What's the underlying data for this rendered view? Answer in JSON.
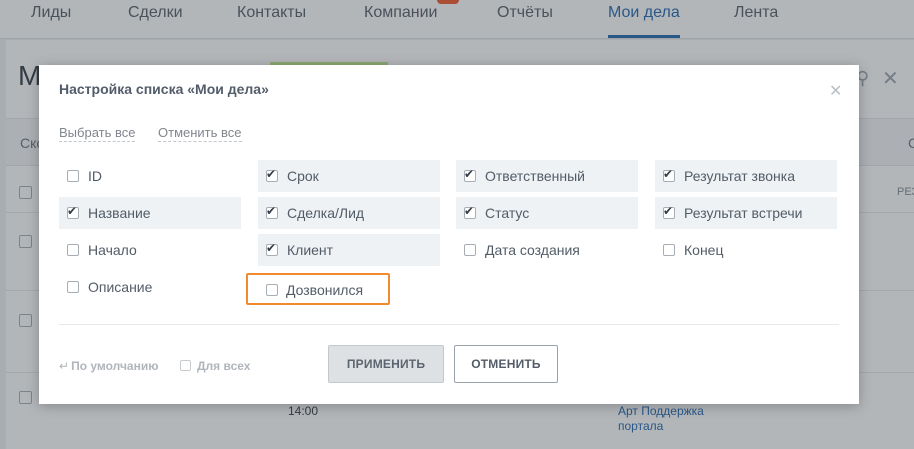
{
  "nav": {
    "tabs": [
      "Лиды",
      "Сделки",
      "Контакты",
      "Компании",
      "Отчёты",
      "Мои дела",
      "Лента"
    ],
    "active": "Мои дела"
  },
  "background": {
    "title": "М",
    "toolbar_text": "Ско",
    "column_header_result": "РЕЗ",
    "column_c": "С",
    "row_time": "14:00",
    "row_link": "Арт Поддержка портала"
  },
  "modal": {
    "title": "Настройка списка «Мои дела»",
    "select_all": "Выбрать все",
    "deselect_all": "Отменить все",
    "options": [
      {
        "label": "ID",
        "checked": false
      },
      {
        "label": "Срок",
        "checked": true
      },
      {
        "label": "Ответственный",
        "checked": true
      },
      {
        "label": "Результат звонка",
        "checked": true
      },
      {
        "label": "Название",
        "checked": true
      },
      {
        "label": "Сделка/Лид",
        "checked": true
      },
      {
        "label": "Статус",
        "checked": true
      },
      {
        "label": "Результат встречи",
        "checked": true
      },
      {
        "label": "Начало",
        "checked": false
      },
      {
        "label": "Клиент",
        "checked": true
      },
      {
        "label": "Дата создания",
        "checked": false
      },
      {
        "label": "Конец",
        "checked": false
      },
      {
        "label": "Описание",
        "checked": false
      },
      {
        "label": "Дозвонился",
        "checked": false,
        "highlighted": true
      }
    ],
    "default_link": "По умолчанию",
    "for_all_label": "Для всех",
    "for_all_checked": false,
    "apply_button": "ПРИМЕНИТЬ",
    "cancel_button": "ОТМЕНИТЬ"
  },
  "colors": {
    "accent": "#2067b0",
    "highlight_border": "#f28b2e",
    "checked_bg": "#eef2f4"
  }
}
